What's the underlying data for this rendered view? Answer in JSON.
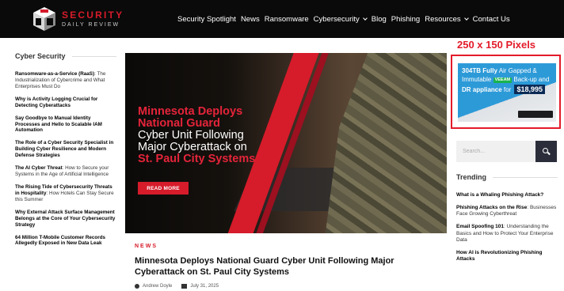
{
  "brand": {
    "title": "SECURITY",
    "subtitle": "DAILY REVIEW",
    "accent": "#d61b2a"
  },
  "nav": {
    "items": [
      {
        "label": "Security Spotlight",
        "dropdown": false
      },
      {
        "label": "News",
        "dropdown": false
      },
      {
        "label": "Ransomware",
        "dropdown": false
      },
      {
        "label": "Cybersecurity",
        "dropdown": true
      },
      {
        "label": "Blog",
        "dropdown": false
      },
      {
        "label": "Phishing",
        "dropdown": false
      },
      {
        "label": "Resources",
        "dropdown": true
      },
      {
        "label": "Contact Us",
        "dropdown": false
      }
    ]
  },
  "left_sidebar": {
    "heading": "Cyber Security",
    "items": [
      {
        "bold": "Ransomware-as-a-Service (RaaS)",
        "rest": ": The Industrialization of Cybercrime and What Enterprises Must Do"
      },
      {
        "bold": "Why is Activity Logging Crucial for Detecting Cyberattacks",
        "rest": ""
      },
      {
        "bold": "Say Goodbye to Manual Identity Processes and Hello to Scalable IAM Automation",
        "rest": ""
      },
      {
        "bold": "The Role of a Cyber Security Specialist in Building Cyber Resilience and Modern Defense Strategies",
        "rest": ""
      },
      {
        "bold": "The AI Cyber Threat",
        "rest": ": How to Secure your Systems in the Age of Artificial Intelligence"
      },
      {
        "bold": "The Rising Tide of Cybersecurity Threats in Hospitality",
        "rest": ": How Hotels Can Stay Secure this Summer"
      },
      {
        "bold": "Why External Attack Surface Management Belongs at the Core of Your Cybersecurity Strategy",
        "rest": ""
      },
      {
        "bold": "64 Million T-Mobile Customer Records Allegedly Exposed in New Data Leak",
        "rest": ""
      }
    ]
  },
  "hero": {
    "line1": "Minnesota Deploys",
    "line2": "National Guard",
    "line3": "Cyber Unit Following",
    "line4": "Major Cyberattack on",
    "line5": "St. Paul City Systems",
    "read_more": "READ MORE"
  },
  "article": {
    "category": "NEWS",
    "title": "Minnesota Deploys National Guard Cyber Unit Following Major Cyberattack on St. Paul City Systems",
    "author": "Andrew Doyle",
    "date": "July 31, 2025"
  },
  "right_sidebar": {
    "ad_label": "250 x 150 Pixels",
    "ad": {
      "t1": "304TB Fully",
      "t2": " Air Gapped &",
      "t3": "Immutable ",
      "veeam": "VEEAM",
      "t4": " Back-up and ",
      "t5": "DR appliance",
      "t6": "for ",
      "price": "$18,995"
    },
    "search_placeholder": "Search...",
    "trending_heading": "Trending",
    "trending": [
      {
        "bold": "What is a Whaling Phishing Attack?",
        "rest": ""
      },
      {
        "bold": "Phishing Attacks on the Rise",
        "rest": ": Businesses Face Growing Cyberthreat"
      },
      {
        "bold": "Email Spoofing 101",
        "rest": ": Understanding the Basics and How to Protect Your Enterprise Data"
      },
      {
        "bold": "How AI is Revolutionizing Phishing Attacks",
        "rest": ""
      }
    ]
  }
}
